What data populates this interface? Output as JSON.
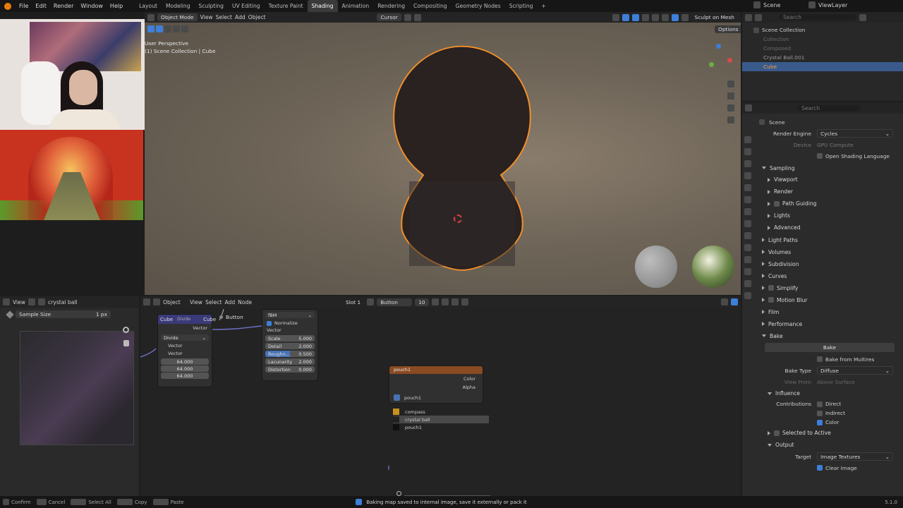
{
  "menu": {
    "items": [
      "File",
      "Edit",
      "Render",
      "Window",
      "Help"
    ],
    "workspaces": [
      "Layout",
      "Modeling",
      "Sculpting",
      "UV Editing",
      "Texture Paint",
      "Shading",
      "Animation",
      "Rendering",
      "Compositing",
      "Geometry Nodes",
      "Scripting"
    ],
    "active_workspace": "Shading",
    "scene_name": "Scene",
    "view_layer": "ViewLayer"
  },
  "image_editor": {
    "view_label": "View",
    "image_name": "crystal ball",
    "sample_label": "Sample Size",
    "sample_value": "1 px"
  },
  "viewport": {
    "mode": "Object Mode",
    "menus": [
      "View",
      "Select",
      "Add",
      "Object"
    ],
    "orientation": "Cursor",
    "sculpt_on_mesh": "Sculpt on Mesh",
    "options": "Options",
    "perspective_label": "User Perspective",
    "collection_path": "(1) Scene Collection | Cube"
  },
  "outliner": {
    "root": "Scene Collection",
    "items": [
      {
        "name": "Collection",
        "dim": true
      },
      {
        "name": "Composed",
        "dim": true
      },
      {
        "name": "Crystal Ball.001",
        "dim": false
      },
      {
        "name": "Cube",
        "dim": false,
        "selected": true
      }
    ],
    "search_placeholder": "Search"
  },
  "properties": {
    "title": "Scene",
    "search_placeholder": "Search",
    "render_engine_label": "Render Engine",
    "render_engine": "Cycles",
    "device_label": "Device",
    "device": "GPU Compute",
    "osl_label": "Open Shading Language",
    "panels": [
      "Sampling",
      "Viewport",
      "Render",
      "Path Guiding",
      "Lights",
      "Advanced",
      "Light Paths",
      "Volumes",
      "Subdivision",
      "Curves",
      "Simplify",
      "Motion Blur",
      "Film",
      "Performance",
      "Bake"
    ],
    "bake_button": "Bake",
    "bake_from_multires": "Bake from Multires",
    "bake_type_label": "Bake Type",
    "bake_type": "Diffuse",
    "view_from_label": "View From",
    "view_from": "Above Surface",
    "influence": "Influence",
    "contributions_label": "Contributions",
    "direct": "Direct",
    "indirect": "Indirect",
    "color": "Color",
    "selected_to_active": "Selected to Active",
    "output": "Output",
    "target_label": "Target",
    "target": "Image Textures",
    "clear_image": "Clear Image"
  },
  "node_editor": {
    "object_label": "Object",
    "menus": [
      "View",
      "Select",
      "Add",
      "Node"
    ],
    "slot": "Slot 1",
    "material": "Button",
    "users": "10",
    "divide_node": {
      "header": "Divide",
      "cube1": "Cube",
      "cube2": "Cube",
      "op": "Divide",
      "vector_out": "Vector",
      "v1": "Vector",
      "v2": "Vector",
      "vals": [
        "64.000",
        "64.000",
        "64.000"
      ]
    },
    "button_label": "Button",
    "noise_node": {
      "type": "fBM",
      "normalize": "Normalize",
      "vector": "Vector",
      "fields": [
        [
          "Scale",
          "5.000"
        ],
        [
          "Detail",
          "2.000"
        ],
        [
          "Roughn...",
          "0.500"
        ],
        [
          "Lacunarity",
          "2.000"
        ],
        [
          "Distortion",
          "0.000"
        ]
      ]
    },
    "image_node": {
      "header": "pouch1",
      "color": "Color",
      "alpha": "Alpha",
      "image": "pouch1",
      "list": [
        "compass",
        "crystal ball",
        "pouch1"
      ]
    }
  },
  "statusbar": {
    "hints": [
      "Confirm",
      "Cancel",
      "Select All",
      "Copy",
      "Paste"
    ],
    "message": "Baking map saved to internal image, save it externally or pack it",
    "version": "5.1.0"
  }
}
